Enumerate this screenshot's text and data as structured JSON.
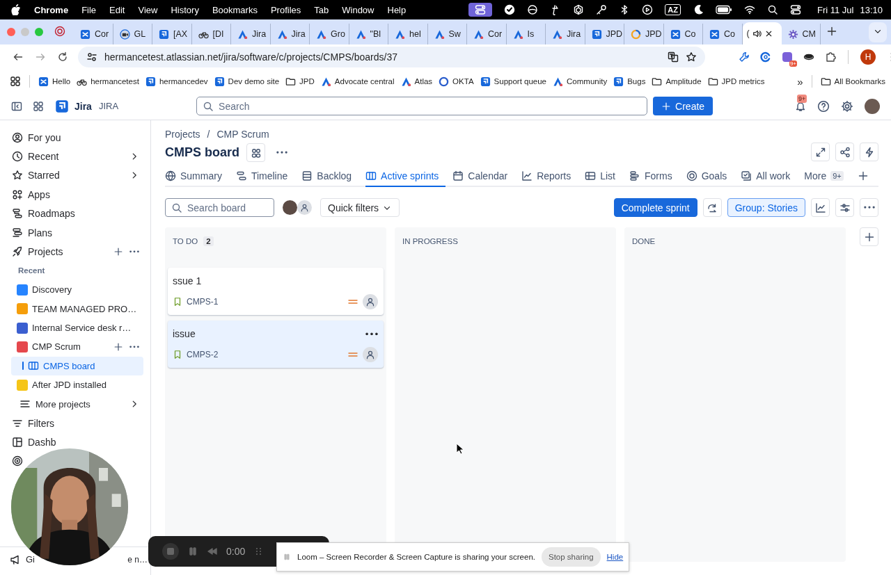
{
  "menubar": {
    "app": "Chrome",
    "menus": [
      "File",
      "Edit",
      "View",
      "History",
      "Bookmarks",
      "Profiles",
      "Tab",
      "Window",
      "Help"
    ],
    "input_source": "AZ",
    "date": "Fri 11 Jul",
    "time": "13:10"
  },
  "browser": {
    "tabs": [
      {
        "title": "Cor",
        "kind": "confluence",
        "selected": false,
        "audio": false
      },
      {
        "title": "GL",
        "kind": "reel",
        "selected": false,
        "audio": false
      },
      {
        "title": "[AX",
        "kind": "jira",
        "selected": false,
        "audio": false
      },
      {
        "title": "[DI",
        "kind": "bike",
        "selected": false,
        "audio": false
      },
      {
        "title": "Jira",
        "kind": "atlassian",
        "selected": false,
        "audio": false
      },
      {
        "title": "Jira",
        "kind": "atlassian",
        "selected": false,
        "audio": false
      },
      {
        "title": "Gro",
        "kind": "atlassian",
        "selected": false,
        "audio": false
      },
      {
        "title": "\"Bl",
        "kind": "atlassian",
        "selected": false,
        "audio": false
      },
      {
        "title": "hel",
        "kind": "atlassian",
        "selected": false,
        "audio": false
      },
      {
        "title": "Sw",
        "kind": "atlassian",
        "selected": false,
        "audio": false
      },
      {
        "title": "Cor",
        "kind": "atlassian",
        "selected": false,
        "audio": false
      },
      {
        "title": "Is",
        "kind": "atlassian",
        "selected": false,
        "audio": false
      },
      {
        "title": "Jira",
        "kind": "atlassian",
        "selected": false,
        "audio": false
      },
      {
        "title": "JPD",
        "kind": "jira",
        "selected": false,
        "audio": false
      },
      {
        "title": "JPD",
        "kind": "jpd",
        "selected": false,
        "audio": false
      },
      {
        "title": "Co",
        "kind": "confluence",
        "selected": false,
        "audio": false
      },
      {
        "title": "Co",
        "kind": "confluence",
        "selected": false,
        "audio": false
      },
      {
        "title": "(",
        "kind": "none",
        "selected": true,
        "audio": true
      },
      {
        "title": "CM",
        "kind": "star",
        "selected": false,
        "audio": false
      }
    ],
    "url": "hermancetest.atlassian.net/jira/software/c/projects/CMPS/boards/37",
    "extension_badge": "9+",
    "profile_initial": "H",
    "bookmarks": [
      {
        "label": "Hello",
        "kind": "confluence"
      },
      {
        "label": "hermancetest",
        "kind": "bike"
      },
      {
        "label": "hermancedev",
        "kind": "jira"
      },
      {
        "label": "Dev demo site",
        "kind": "jira"
      },
      {
        "label": "JPD",
        "kind": "folder"
      },
      {
        "label": "Advocate central",
        "kind": "atlassian"
      },
      {
        "label": "Atlas",
        "kind": "atlassian"
      },
      {
        "label": "OKTA",
        "kind": "okta"
      },
      {
        "label": "Support queue",
        "kind": "jira"
      },
      {
        "label": "Community",
        "kind": "atlassian"
      },
      {
        "label": "Bugs",
        "kind": "jira"
      },
      {
        "label": "Amplitude",
        "kind": "folder"
      },
      {
        "label": "JPD metrics",
        "kind": "folder"
      }
    ],
    "more_bookmarks": "»",
    "all_bookmarks": "All Bookmarks"
  },
  "jira": {
    "product": "Jira",
    "site": "JIRA",
    "search": {
      "placeholder": "Search"
    },
    "create": "Create",
    "notifications_badge": "9+"
  },
  "sidebar": {
    "nav": [
      {
        "label": "For you",
        "has_submenu": false
      },
      {
        "label": "Recent",
        "has_submenu": true
      },
      {
        "label": "Starred",
        "has_submenu": true
      },
      {
        "label": "Apps",
        "has_submenu": false
      },
      {
        "label": "Roadmaps",
        "has_submenu": false
      },
      {
        "label": "Plans",
        "has_submenu": false
      }
    ],
    "projects_label": "Projects",
    "recent_heading": "Recent",
    "projects": [
      {
        "label": "Discovery",
        "color": "#2684ff",
        "selected": false,
        "actions_visible": false
      },
      {
        "label": "TEAM MANAGED PRO…",
        "color": "#f59e0b",
        "selected": false,
        "actions_visible": false
      },
      {
        "label": "Internal Service desk r…",
        "color": "#3b5fd0",
        "selected": false,
        "actions_visible": false
      },
      {
        "label": "CMP Scrum",
        "color": "#e5484d",
        "selected": false,
        "actions_visible": true,
        "children": [
          {
            "label": "CMPS board",
            "selected": true
          }
        ]
      },
      {
        "label": "After JPD installed",
        "color": "#f5c518",
        "selected": false,
        "actions_visible": false
      }
    ],
    "more_projects": "More projects",
    "after": [
      {
        "label": "Filters"
      },
      {
        "label": "Dashb"
      }
    ],
    "footer_start": "Gi",
    "footer_end": "e n…"
  },
  "board": {
    "breadcrumbs": [
      "Projects",
      "CMP Scrum"
    ],
    "breadcrumb_separator": "/",
    "title": "CMPS board",
    "tabs": [
      {
        "label": "Summary",
        "selected": false
      },
      {
        "label": "Timeline",
        "selected": false
      },
      {
        "label": "Backlog",
        "selected": false
      },
      {
        "label": "Active sprints",
        "selected": true
      },
      {
        "label": "Calendar",
        "selected": false
      },
      {
        "label": "Reports",
        "selected": false
      },
      {
        "label": "List",
        "selected": false
      },
      {
        "label": "Forms",
        "selected": false
      },
      {
        "label": "Goals",
        "selected": false
      },
      {
        "label": "All work",
        "selected": false
      }
    ],
    "more_tab": "More",
    "more_badge": "9+",
    "search": {
      "placeholder": "Search board"
    },
    "quick_filters": "Quick filters",
    "complete": "Complete sprint",
    "group": {
      "label": "Group: Stories",
      "pressed": true
    },
    "columns": [
      {
        "title": "TO DO",
        "count": "2",
        "cards": [
          {
            "title": "ssue 1",
            "key": "CMPS-1",
            "selected": false
          },
          {
            "title": "issue",
            "key": "CMPS-2",
            "selected": true
          }
        ]
      },
      {
        "title": "IN PROGRESS"
      },
      {
        "title": "DONE"
      }
    ]
  },
  "loom": {
    "time": "0:00",
    "message": "Loom – Screen Recorder & Screen Capture is sharing your screen.",
    "stop": "Stop sharing",
    "hide": "Hide"
  }
}
